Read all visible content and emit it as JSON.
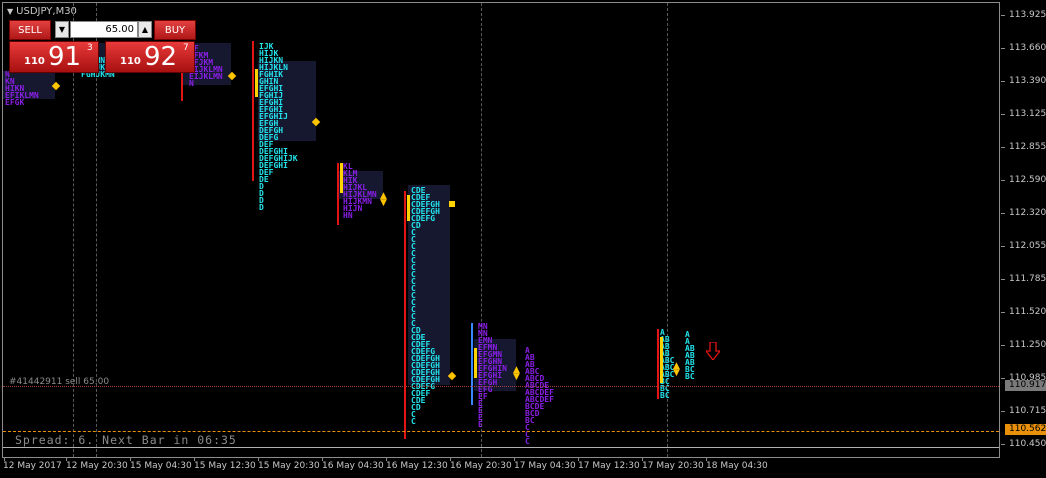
{
  "chart": {
    "symbol": "USDJPY,M30",
    "order_label": "#41442911 sell 65.00",
    "spread_line": "Spread: 6. Next Bar in 06:35"
  },
  "trade_panel": {
    "sell_label": "SELL",
    "buy_label": "BUY",
    "lot_value": "65.00",
    "sell_quote": {
      "prefix": "110",
      "big": "91",
      "sup": "3"
    },
    "buy_quote": {
      "prefix": "110",
      "big": "92",
      "sup": "7"
    }
  },
  "price_axis": {
    "labels": [
      "113.925",
      "113.660",
      "113.390",
      "113.125",
      "112.855",
      "112.590",
      "112.320",
      "112.055",
      "111.785",
      "111.520",
      "111.250",
      "110.985",
      "110.715",
      "110.450"
    ],
    "current_price_tag": "110.917",
    "bid_price_tag": "110.562"
  },
  "time_axis": {
    "labels": [
      "12 May 2017",
      "12 May 20:30",
      "15 May 04:30",
      "15 May 12:30",
      "15 May 20:30",
      "16 May 04:30",
      "16 May 12:30",
      "16 May 20:30",
      "17 May 04:30",
      "17 May 12:30",
      "17 May 20:30",
      "18 May 04:30"
    ]
  },
  "colors": {
    "background": "#000000",
    "tpo_purple": "#8a1ee6",
    "tpo_cyan": "#22e6ee",
    "poc_red": "#e21414",
    "value_yellow": "#ffd400",
    "order_line": "#a04040",
    "bid_line": "#e8900a",
    "current_tag_bg": "#7a7a7a",
    "bid_tag_bg": "#e8900a"
  },
  "profiles": [
    {
      "text": "N\nKN\nHIKN\nEFIKLMN\nEFGK",
      "cls": "pur"
    },
    {
      "text": "IKN\nKN\nHIKMN\nEHIJKLMN\nFGHJKMN",
      "cls": "cya"
    },
    {
      "text": "EF\nEFKM\nEFJKM\nEIJKLMN\nEIJKLMN\nN",
      "cls": "pur"
    },
    {
      "text": "IJK\nHIJK\nHIJKN\nHIJKLN\nFGHIK\nGHIN\nEFGHI\nFGHIJ\nEFGHI\nEFGHI\nEFGHIJ\nEFGH\nDEFGH\nDEFG\nDEF\nDEFGHI\nDEFGHIJK\nDEFGHI\nDEF\nDE\nD\nD\nD\nD",
      "cls": "cya"
    },
    {
      "text": "KL\nKLM\nHIK\nHIJKL\nHIJKLMN\nHIJKMN\nHIJN\nHN",
      "cls": "pur"
    },
    {
      "text": "CDE\nCDEF\nCDEFGH\nCDEFGH\nCDEFG\nCD\nC\nC\nC\nC\nC\nC\nC\nC\nC\nC\nC\nC\nC\nC\nCD\nCDE\nCDEF\nCDEFG\nCDEFGH\nCDEFGH\nCDEFGH\nCDEFGH\nCDEFG\nCDEF\nCDE\nCD\nC\nC",
      "cls": "cya"
    },
    {
      "text": "MN\nMN\nEMN\nEFMN\nEFGMN\nEFGHN\nEFGHIN\nEFGHI\nEFGH\nEFG\nEF\nE\nE\nE\nE",
      "cls": "pur"
    },
    {
      "text": "A\nAB\nAB\nABC\nABCD\nABCDE\nABCDEF\nABCDEF\nBCDE\nBCD\nBC\nC\nC\nC",
      "cls": "pur"
    },
    {
      "text": "A\nAB\nAB\nAB\nABC\nABC\nABC\nBC\nBC\nBC",
      "cls": "cya"
    },
    {
      "text": "A\nA\nAB\nAB\nAB\nBC\nBC",
      "cls": "cya"
    }
  ]
}
